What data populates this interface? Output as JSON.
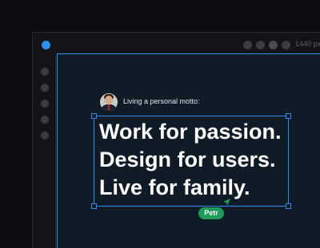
{
  "toolbar": {
    "width_readout": "1440 px"
  },
  "artboard": {
    "label": "Living a personal motto:",
    "lines": [
      "Work for passion.",
      "Design for users.",
      "Live for family."
    ]
  },
  "cursor": {
    "name": "Petr",
    "color": "#1f9b5a"
  },
  "colors": {
    "accent": "#2f8cf0",
    "background": "#0b0c10",
    "artboard": "#0f1b26"
  },
  "icons": [
    "brand-dot-icon",
    "cursor-arrow-icon"
  ]
}
